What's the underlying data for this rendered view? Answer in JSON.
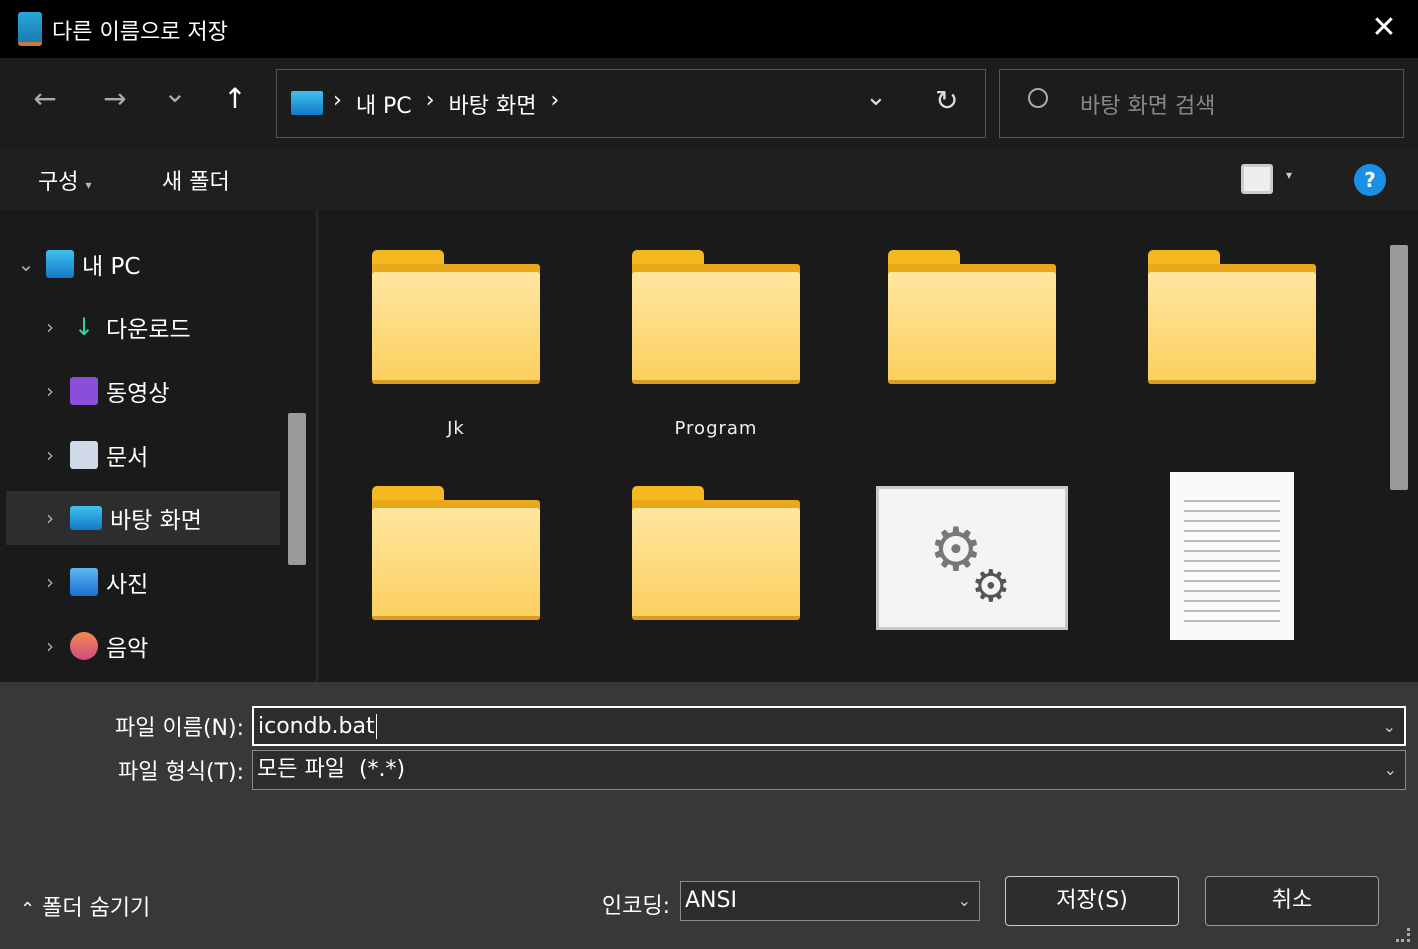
{
  "window": {
    "title": "다른 이름으로 저장",
    "close": "✕",
    "icon": "notepad-icon"
  },
  "nav": {
    "back": "←",
    "forward": "→",
    "recent": "⌄",
    "up": "↑",
    "breadcrumb": [
      "내 PC",
      "바탕 화면"
    ],
    "separator": "›",
    "dropdown": "⌄",
    "refresh": "↻",
    "search_placeholder": "바탕 화면 검색"
  },
  "commands": {
    "organize": "구성",
    "organize_arrow": "▾",
    "new_folder": "새 폴더",
    "view_arrow": "▾",
    "help": "?"
  },
  "tree": [
    {
      "label": "내 PC",
      "chevron": "⌄",
      "icon": "computer-icon"
    },
    {
      "label": "다운로드",
      "chevron": "›",
      "icon": "download-icon"
    },
    {
      "label": "동영상",
      "chevron": "›",
      "icon": "video-icon"
    },
    {
      "label": "문서",
      "chevron": "›",
      "icon": "document-icon"
    },
    {
      "label": "바탕 화면",
      "chevron": "›",
      "icon": "desktop-icon",
      "selected": true
    },
    {
      "label": "사진",
      "chevron": "›",
      "icon": "pictures-icon"
    },
    {
      "label": "음악",
      "chevron": "›",
      "icon": "music-icon"
    }
  ],
  "files": [
    {
      "label": "Jk",
      "type": "folder"
    },
    {
      "label": "Program",
      "type": "folder"
    },
    {
      "label": "",
      "type": "folder"
    },
    {
      "label": "",
      "type": "folder"
    },
    {
      "label": "",
      "type": "folder"
    },
    {
      "label": "",
      "type": "folder"
    },
    {
      "label": "",
      "type": "settings-file"
    },
    {
      "label": "",
      "type": "text-file"
    }
  ],
  "form": {
    "filename_label": "파일 이름(N):",
    "filename_value": "icondb.bat",
    "filetype_label": "파일 형식(T):",
    "filetype_value": "모든 파일  (*.*)",
    "dropdown_arrow": "⌄",
    "encoding_label": "인코딩:",
    "encoding_value": "ANSI"
  },
  "footer": {
    "hide_folders": "폴더 숨기기",
    "hide_arrow": "⌃",
    "save": "저장(S)",
    "cancel": "취소"
  }
}
